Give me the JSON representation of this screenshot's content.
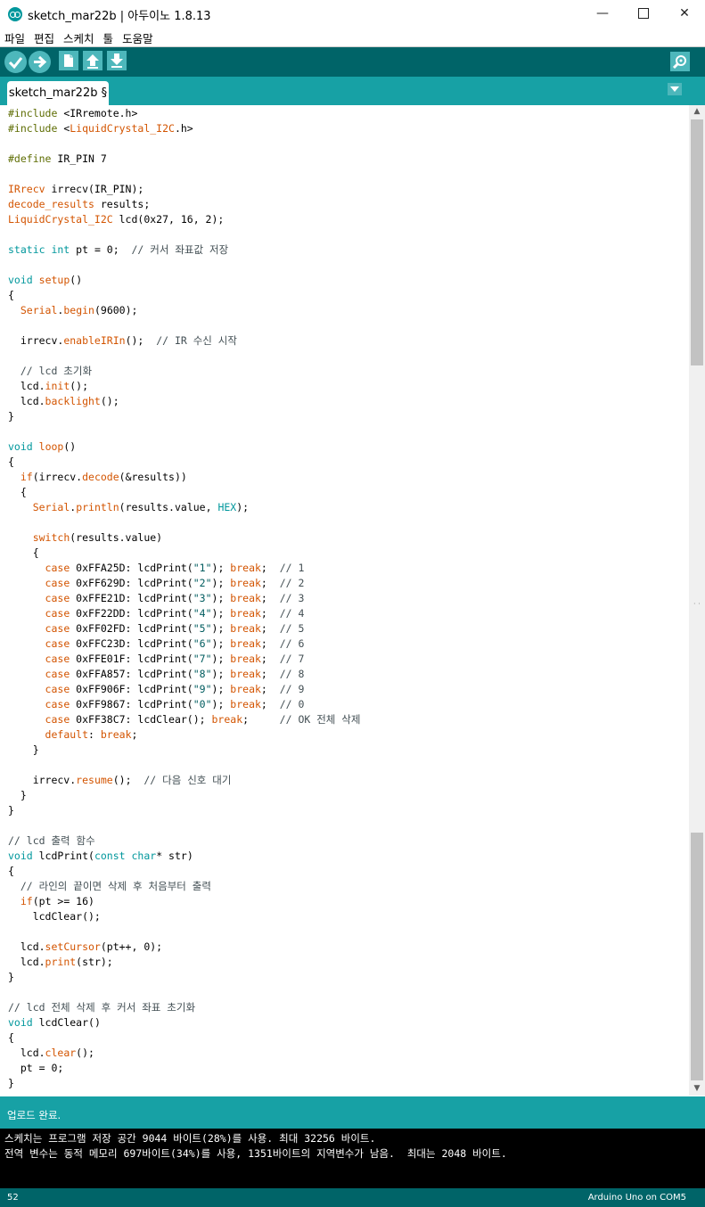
{
  "window": {
    "title": "sketch_mar22b | 아두이노 1.8.13",
    "minimize": "—",
    "close": "✕"
  },
  "menu": [
    "파일",
    "편집",
    "스케치",
    "툴",
    "도움말"
  ],
  "toolbar": [
    "verify-button",
    "upload-button",
    "new-button",
    "open-button",
    "save-button",
    "serial-monitor-button"
  ],
  "tab": {
    "label": "sketch_mar22b §"
  },
  "code": [
    [
      [
        "k-pre",
        "#include "
      ],
      [
        "",
        "<IRremote.h>"
      ]
    ],
    [
      [
        "k-pre",
        "#include "
      ],
      [
        "",
        "<"
      ],
      [
        "k-lib",
        "LiquidCrystal_I2C"
      ],
      [
        "",
        ".h>"
      ]
    ],
    [],
    [
      [
        "k-pre",
        "#define "
      ],
      [
        "",
        "IR_PIN 7"
      ]
    ],
    [],
    [
      [
        "k-lib",
        "IRrecv"
      ],
      [
        "",
        " irrecv(IR_PIN);"
      ]
    ],
    [
      [
        "k-lib",
        "decode_results"
      ],
      [
        "",
        " results;"
      ]
    ],
    [
      [
        "k-lib",
        "LiquidCrystal_I2C"
      ],
      [
        "",
        " lcd(0x27, 16, 2);"
      ]
    ],
    [],
    [
      [
        "k-blue",
        "static int"
      ],
      [
        "",
        " pt = 0;  "
      ],
      [
        "k-cmt",
        "// 커서 좌표값 저장"
      ]
    ],
    [],
    [
      [
        "k-blue",
        "void"
      ],
      [
        "",
        " "
      ],
      [
        "k-lib",
        "setup"
      ],
      [
        "",
        "()"
      ]
    ],
    [
      [
        "",
        "{"
      ]
    ],
    [
      [
        "",
        "  "
      ],
      [
        "k-lib",
        "Serial"
      ],
      [
        "",
        "."
      ],
      [
        "k-lib",
        "begin"
      ],
      [
        "",
        "(9600);"
      ]
    ],
    [],
    [
      [
        "",
        "  irrecv."
      ],
      [
        "k-lib",
        "enableIRIn"
      ],
      [
        "",
        "();  "
      ],
      [
        "k-cmt",
        "// IR 수신 시작"
      ]
    ],
    [],
    [
      [
        "k-cmt",
        "  // lcd 초기화"
      ]
    ],
    [
      [
        "",
        "  lcd."
      ],
      [
        "k-lib",
        "init"
      ],
      [
        "",
        "();"
      ]
    ],
    [
      [
        "",
        "  lcd."
      ],
      [
        "k-lib",
        "backlight"
      ],
      [
        "",
        "();"
      ]
    ],
    [
      [
        "",
        "}"
      ]
    ],
    [],
    [
      [
        "k-blue",
        "void"
      ],
      [
        "",
        " "
      ],
      [
        "k-lib",
        "loop"
      ],
      [
        "",
        "()"
      ]
    ],
    [
      [
        "",
        "{"
      ]
    ],
    [
      [
        "",
        "  "
      ],
      [
        "k-lib",
        "if"
      ],
      [
        "",
        "(irrecv."
      ],
      [
        "k-lib",
        "decode"
      ],
      [
        "",
        "(&results))"
      ]
    ],
    [
      [
        "",
        "  {"
      ]
    ],
    [
      [
        "",
        "    "
      ],
      [
        "k-lib",
        "Serial"
      ],
      [
        "",
        "."
      ],
      [
        "k-lib",
        "println"
      ],
      [
        "",
        "(results.value, "
      ],
      [
        "k-blue",
        "HEX"
      ],
      [
        "",
        ");"
      ]
    ],
    [],
    [
      [
        "",
        "    "
      ],
      [
        "k-lib",
        "switch"
      ],
      [
        "",
        "(results.value)"
      ]
    ],
    [
      [
        "",
        "    {"
      ]
    ],
    [
      [
        "",
        "      "
      ],
      [
        "k-lib",
        "case"
      ],
      [
        "",
        " 0xFFA25D: lcdPrint("
      ],
      [
        "k-str",
        "\"1\""
      ],
      [
        "",
        "); "
      ],
      [
        "k-lib",
        "break"
      ],
      [
        "",
        ";  "
      ],
      [
        "k-cmt",
        "// 1"
      ]
    ],
    [
      [
        "",
        "      "
      ],
      [
        "k-lib",
        "case"
      ],
      [
        "",
        " 0xFF629D: lcdPrint("
      ],
      [
        "k-str",
        "\"2\""
      ],
      [
        "",
        "); "
      ],
      [
        "k-lib",
        "break"
      ],
      [
        "",
        ";  "
      ],
      [
        "k-cmt",
        "// 2"
      ]
    ],
    [
      [
        "",
        "      "
      ],
      [
        "k-lib",
        "case"
      ],
      [
        "",
        " 0xFFE21D: lcdPrint("
      ],
      [
        "k-str",
        "\"3\""
      ],
      [
        "",
        "); "
      ],
      [
        "k-lib",
        "break"
      ],
      [
        "",
        ";  "
      ],
      [
        "k-cmt",
        "// 3"
      ]
    ],
    [
      [
        "",
        "      "
      ],
      [
        "k-lib",
        "case"
      ],
      [
        "",
        " 0xFF22DD: lcdPrint("
      ],
      [
        "k-str",
        "\"4\""
      ],
      [
        "",
        "); "
      ],
      [
        "k-lib",
        "break"
      ],
      [
        "",
        ";  "
      ],
      [
        "k-cmt",
        "// 4"
      ]
    ],
    [
      [
        "",
        "      "
      ],
      [
        "k-lib",
        "case"
      ],
      [
        "",
        " 0xFF02FD: lcdPrint("
      ],
      [
        "k-str",
        "\"5\""
      ],
      [
        "",
        "); "
      ],
      [
        "k-lib",
        "break"
      ],
      [
        "",
        ";  "
      ],
      [
        "k-cmt",
        "// 5"
      ]
    ],
    [
      [
        "",
        "      "
      ],
      [
        "k-lib",
        "case"
      ],
      [
        "",
        " 0xFFC23D: lcdPrint("
      ],
      [
        "k-str",
        "\"6\""
      ],
      [
        "",
        "); "
      ],
      [
        "k-lib",
        "break"
      ],
      [
        "",
        ";  "
      ],
      [
        "k-cmt",
        "// 6"
      ]
    ],
    [
      [
        "",
        "      "
      ],
      [
        "k-lib",
        "case"
      ],
      [
        "",
        " 0xFFE01F: lcdPrint("
      ],
      [
        "k-str",
        "\"7\""
      ],
      [
        "",
        "); "
      ],
      [
        "k-lib",
        "break"
      ],
      [
        "",
        ";  "
      ],
      [
        "k-cmt",
        "// 7"
      ]
    ],
    [
      [
        "",
        "      "
      ],
      [
        "k-lib",
        "case"
      ],
      [
        "",
        " 0xFFA857: lcdPrint("
      ],
      [
        "k-str",
        "\"8\""
      ],
      [
        "",
        "); "
      ],
      [
        "k-lib",
        "break"
      ],
      [
        "",
        ";  "
      ],
      [
        "k-cmt",
        "// 8"
      ]
    ],
    [
      [
        "",
        "      "
      ],
      [
        "k-lib",
        "case"
      ],
      [
        "",
        " 0xFF906F: lcdPrint("
      ],
      [
        "k-str",
        "\"9\""
      ],
      [
        "",
        "); "
      ],
      [
        "k-lib",
        "break"
      ],
      [
        "",
        ";  "
      ],
      [
        "k-cmt",
        "// 9"
      ]
    ],
    [
      [
        "",
        "      "
      ],
      [
        "k-lib",
        "case"
      ],
      [
        "",
        " 0xFF9867: lcdPrint("
      ],
      [
        "k-str",
        "\"0\""
      ],
      [
        "",
        "); "
      ],
      [
        "k-lib",
        "break"
      ],
      [
        "",
        ";  "
      ],
      [
        "k-cmt",
        "// 0"
      ]
    ],
    [
      [
        "",
        "      "
      ],
      [
        "k-lib",
        "case"
      ],
      [
        "",
        " 0xFF38C7: lcdClear(); "
      ],
      [
        "k-lib",
        "break"
      ],
      [
        "",
        ";     "
      ],
      [
        "k-cmt",
        "// OK 전체 삭제"
      ]
    ],
    [
      [
        "",
        "      "
      ],
      [
        "k-lib",
        "default"
      ],
      [
        "",
        ": "
      ],
      [
        "k-lib",
        "break"
      ],
      [
        "",
        ";"
      ]
    ],
    [
      [
        "",
        "    }"
      ]
    ],
    [],
    [
      [
        "",
        "    irrecv."
      ],
      [
        "k-lib",
        "resume"
      ],
      [
        "",
        "();  "
      ],
      [
        "k-cmt",
        "// 다음 신호 대기"
      ]
    ],
    [
      [
        "",
        "  }"
      ]
    ],
    [
      [
        "",
        "}"
      ]
    ],
    [],
    [
      [
        "k-cmt",
        "// lcd 출력 함수"
      ]
    ],
    [
      [
        "k-blue",
        "void"
      ],
      [
        "",
        " lcdPrint("
      ],
      [
        "k-blue",
        "const char"
      ],
      [
        "",
        "* str)"
      ]
    ],
    [
      [
        "",
        "{"
      ]
    ],
    [
      [
        "k-cmt",
        "  // 라인의 끝이면 삭제 후 처음부터 출력"
      ]
    ],
    [
      [
        "",
        "  "
      ],
      [
        "k-lib",
        "if"
      ],
      [
        "",
        "(pt >= 16)"
      ]
    ],
    [
      [
        "",
        "    lcdClear();"
      ]
    ],
    [],
    [
      [
        "",
        "  lcd."
      ],
      [
        "k-lib",
        "setCursor"
      ],
      [
        "",
        "(pt++, 0);"
      ]
    ],
    [
      [
        "",
        "  lcd."
      ],
      [
        "k-lib",
        "print"
      ],
      [
        "",
        "(str);"
      ]
    ],
    [
      [
        "",
        "}"
      ]
    ],
    [],
    [
      [
        "k-cmt",
        "// lcd 전체 삭제 후 커서 좌표 초기화"
      ]
    ],
    [
      [
        "k-blue",
        "void"
      ],
      [
        "",
        " lcdClear()"
      ]
    ],
    [
      [
        "",
        "{"
      ]
    ],
    [
      [
        "",
        "  lcd."
      ],
      [
        "k-lib",
        "clear"
      ],
      [
        "",
        "();"
      ]
    ],
    [
      [
        "",
        "  pt = 0;"
      ]
    ],
    [
      [
        "",
        "}"
      ]
    ]
  ],
  "status": {
    "message": "업로드 완료."
  },
  "console": [
    "스케치는 프로그램 저장 공간 9044 바이트(28%)를 사용. 최대 32256 바이트.",
    "전역 변수는 동적 메모리 697바이트(34%)를 사용, 1351바이트의 지역변수가 남음.  최대는 2048 바이트."
  ],
  "footer": {
    "line_number": "52",
    "board": "Arduino Uno on COM5"
  }
}
